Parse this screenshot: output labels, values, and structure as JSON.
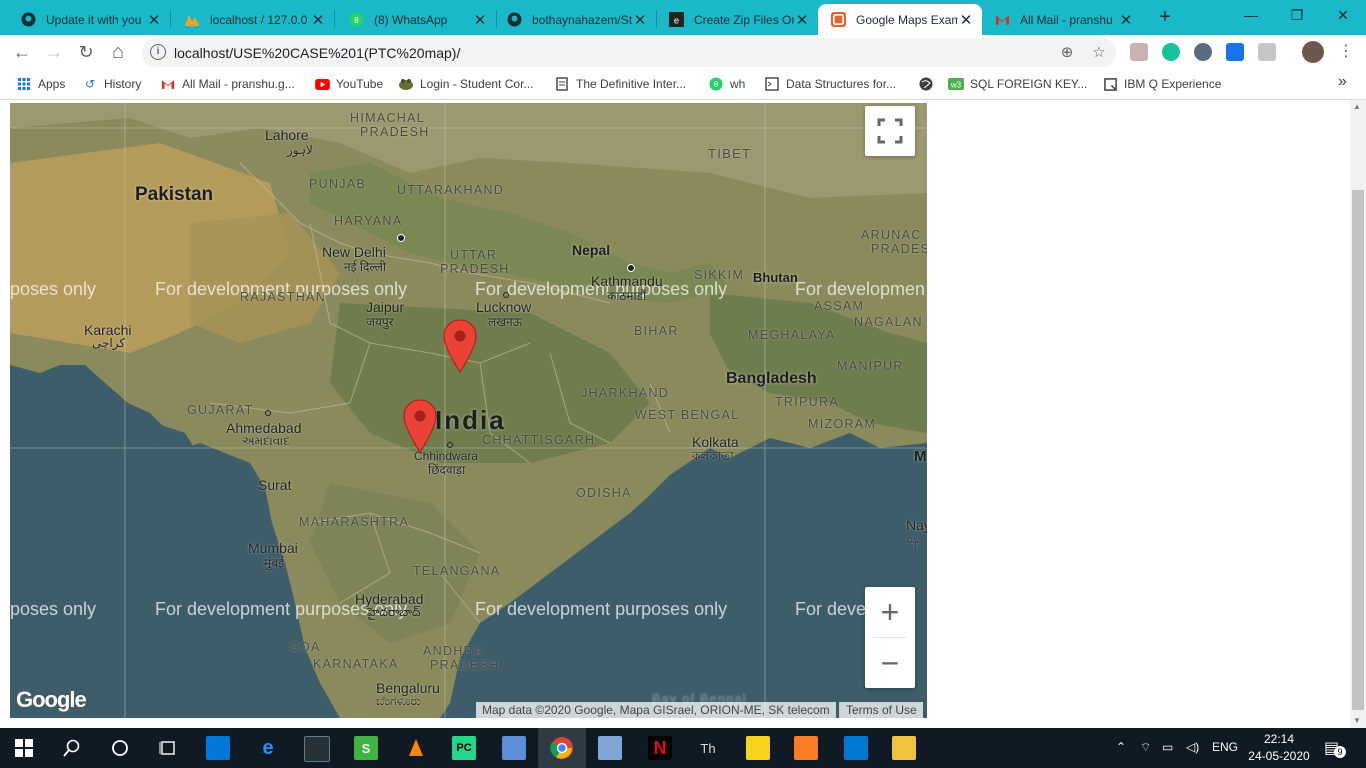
{
  "browser": {
    "tabs": [
      {
        "title": "Update it with you",
        "icon": "github-icon",
        "active": false
      },
      {
        "title": "localhost / 127.0.0",
        "icon": "phpmyadmin-icon",
        "active": false
      },
      {
        "title": "(8) WhatsApp",
        "icon": "whatsapp-icon",
        "active": false
      },
      {
        "title": "bothaynahazem/St",
        "icon": "github-icon",
        "active": false
      },
      {
        "title": "Create Zip Files Or",
        "icon": "ez-icon",
        "active": false
      },
      {
        "title": "Google Maps Exam",
        "icon": "html5-icon",
        "active": true
      },
      {
        "title": "All Mail - pranshu",
        "icon": "gmail-icon",
        "active": false
      }
    ],
    "new_tab": "+",
    "window": {
      "minimize": "—",
      "restore": "❐",
      "close": "✕"
    },
    "nav": {
      "back": "←",
      "forward": "→",
      "reload": "↻",
      "home": "⌂"
    },
    "address": "localhost/USE%20CASE%201(PTC%20map)/",
    "bookmarks": [
      {
        "label": "Apps",
        "icon": "apps-grid-icon"
      },
      {
        "label": "History",
        "icon": "history-icon"
      },
      {
        "label": "All Mail - pranshu.g...",
        "icon": "gmail-icon"
      },
      {
        "label": "YouTube",
        "icon": "youtube-icon"
      },
      {
        "label": "Login - Student Cor...",
        "icon": "frog-icon"
      },
      {
        "label": "The Definitive Inter...",
        "icon": "page-icon"
      },
      {
        "label": "wh",
        "icon": "whatsapp-icon"
      },
      {
        "label": "Data Structures for...",
        "icon": "terminal-icon"
      },
      {
        "label": "",
        "icon": "globe-icon"
      },
      {
        "label": "SQL FOREIGN KEY...",
        "icon": "w3-icon"
      },
      {
        "label": "IBM Q Experience",
        "icon": "q-icon"
      }
    ],
    "bookmarks_more": "»"
  },
  "map": {
    "watermark": "For development purposes only",
    "watermark_left": "poses only",
    "watermark_right": "For developmen",
    "watermark_right2": "For deve",
    "countries": {
      "pakistan": "Pakistan",
      "nepal": "Nepal",
      "india": "India",
      "bangladesh": "Bangladesh",
      "bhutan": "Bhutan",
      "tibet": "TIBET",
      "m": "M"
    },
    "regions": {
      "himachal": "HIMACHAL",
      "pradesh1": "PRADESH",
      "punjab": "PUNJAB",
      "uttarakhand": "UTTARAKHAND",
      "haryana": "HARYANA",
      "uttar": "UTTAR",
      "pradesh2": "PRADESH",
      "rajasthan": "RAJASTHAN",
      "sikkim": "SIKKIM",
      "arunachal": "ARUNAC",
      "pradesh3": "PRADES",
      "assam": "ASSAM",
      "nagaland": "NAGALAN",
      "bihar": "BIHAR",
      "meghalaya": "MEGHALAYA",
      "manipur": "MANIPUR",
      "jharkhand": "JHARKHAND",
      "tripura": "TRIPURA",
      "gujarat": "GUJARAT",
      "westbengal": "WEST BENGAL",
      "mizoram": "MIZORAM",
      "chhattisgarh": "CHHATTISGARH",
      "odisha": "ODISHA",
      "maharashtra": "MAHARASHTRA",
      "telangana": "TELANGANA",
      "goa": "GOA",
      "andhra": "ANDHRA",
      "karnataka": "KARNATAKA",
      "pradesh4": "PRADESH",
      "bay": "Bay of Bengal"
    },
    "cities": {
      "lahore": "Lahore",
      "lahore_local": "لاہور",
      "delhi": "New Delhi",
      "delhi_local": "नई दिल्ली",
      "kathmandu": "Kathmandu",
      "kathmandu_local": "काठमाडौं",
      "jaipur": "Jaipur",
      "jaipur_local": "जयपुर",
      "lucknow": "Lucknow",
      "lucknow_local": "लखनऊ",
      "karachi": "Karachi",
      "karachi_local": "کراچی",
      "ahmedabad": "Ahmedabad",
      "ahmedabad_local": "અમદાવાદ",
      "chhindwara": "Chhindwara",
      "chhindwara_local": "छिंदवाड़ा",
      "kolkata": "Kolkata",
      "kolkata_local": "কলকাতা",
      "surat": "Surat",
      "mumbai": "Mumbai",
      "mumbai_local": "मुंबई",
      "hyderabad": "Hyderabad",
      "hyderabad_local": "హైదరాబాద్",
      "bengaluru": "Bengaluru",
      "bengaluru_local": "ಬೆಂಗಳೂರು",
      "nay": "Nay",
      "nay_local": "နေ"
    },
    "logo": "Google",
    "attribution": "Map data ©2020 Google, Mapa GISrael, ORION-ME, SK telecom",
    "terms": "Terms of Use",
    "zoom_in": "+",
    "zoom_out": "−",
    "markers": [
      {
        "name": "marker-north"
      },
      {
        "name": "marker-chhindwara"
      }
    ]
  },
  "taskbar": {
    "lang": "ENG",
    "time": "22:14",
    "date": "24-05-2020",
    "notifications": "9",
    "apps": [
      "start-icon",
      "search-icon",
      "cortana-icon",
      "task-view-icon",
      "store-icon",
      "edge-icon",
      "mysql-icon",
      "sublime-icon",
      "vlc-icon",
      "pycharm-icon",
      "desktop-icon",
      "chrome-icon",
      "remote-icon",
      "netflix-icon",
      "typora-icon",
      "sticky-notes-icon",
      "xampp-icon",
      "vscode-icon",
      "explorer-icon"
    ]
  },
  "colors": {
    "tabstrip": "#1ab9c9",
    "marker": "#ea4335",
    "water": "#3f5f6c",
    "land": "#8a8a5c"
  }
}
